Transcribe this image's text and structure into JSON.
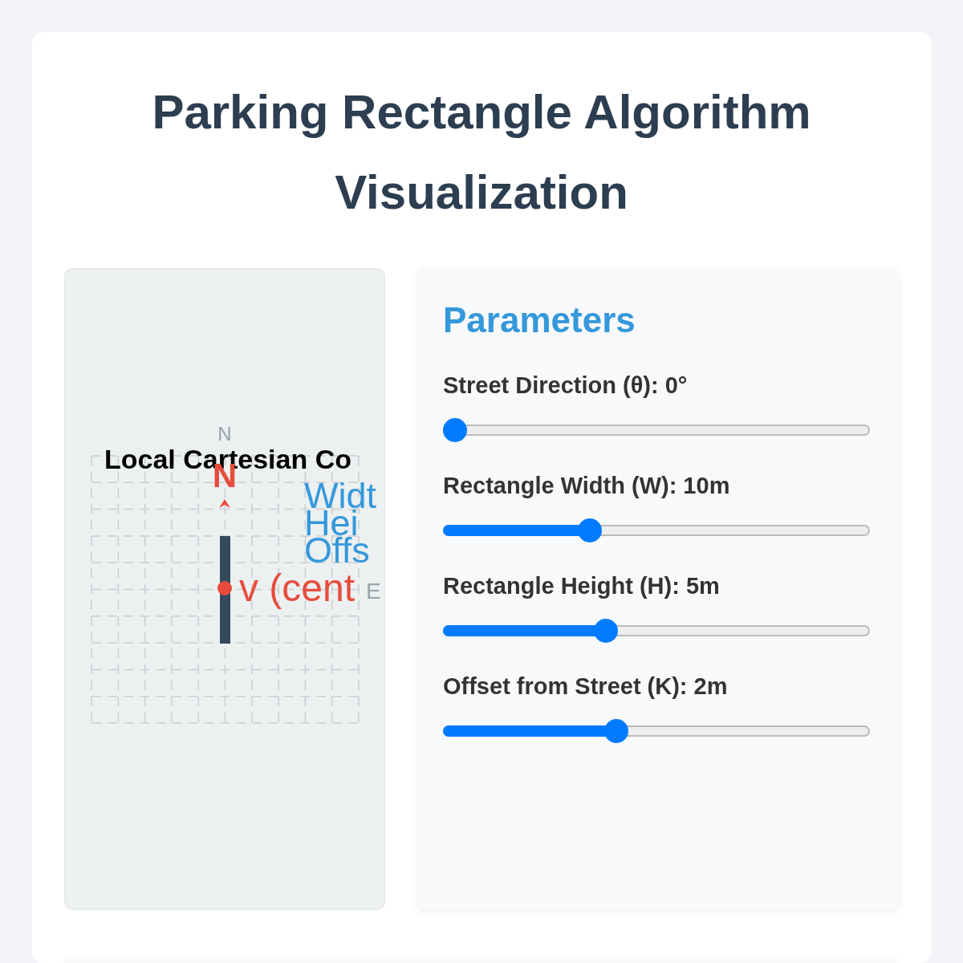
{
  "title": "Parking Rectangle Algorithm Visualization",
  "visualization": {
    "north_label": "N",
    "title": "Local Cartesian Co",
    "north_marker": "N",
    "legend": [
      "Widt",
      "Hei",
      "Offs"
    ],
    "center_label": "v (cent",
    "east_label": "E"
  },
  "parameters": {
    "heading": "Parameters",
    "sliders": [
      {
        "label": "Street Direction (θ): 0°",
        "level": 0
      },
      {
        "label": "Rectangle Width (W): 10m",
        "level": 0.335
      },
      {
        "label": "Rectangle Height (H): 5m",
        "level": 0.375
      },
      {
        "label": "Offset from Street (K): 2m",
        "level": 0.4
      }
    ]
  }
}
